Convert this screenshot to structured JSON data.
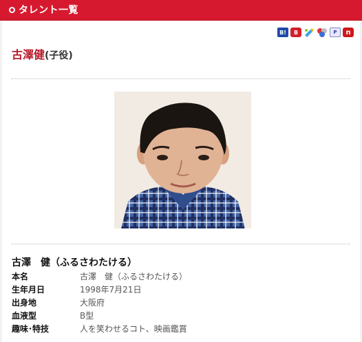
{
  "header": {
    "title": "タレント一覧"
  },
  "share_icons": [
    {
      "name": "hatena-bookmark-icon",
      "glyph": "B!"
    },
    {
      "name": "buzzurl-icon",
      "glyph": "B"
    },
    {
      "name": "livedoor-clip-icon",
      "glyph": ""
    },
    {
      "name": "delicious-icon",
      "glyph": ""
    },
    {
      "name": "pookmark-icon",
      "glyph": "P"
    },
    {
      "name": "newsing-icon",
      "glyph": "n"
    }
  ],
  "talent": {
    "name": "古澤健",
    "role": "(子役)",
    "full_name": "古澤　健（ふるさわたける）"
  },
  "profile": {
    "rows": [
      {
        "label": "本名",
        "value": "古澤　健（ふるさわたける）"
      },
      {
        "label": "生年月日",
        "value": "1998年7月21日"
      },
      {
        "label": "出身地",
        "value": "大阪府"
      },
      {
        "label": "血液型",
        "value": "B型"
      },
      {
        "label": "趣味･特技",
        "value": "人を笑わせるコト、映画鑑賞"
      }
    ]
  },
  "colors": {
    "accent": "#d7192f",
    "name": "#b71a2a"
  }
}
